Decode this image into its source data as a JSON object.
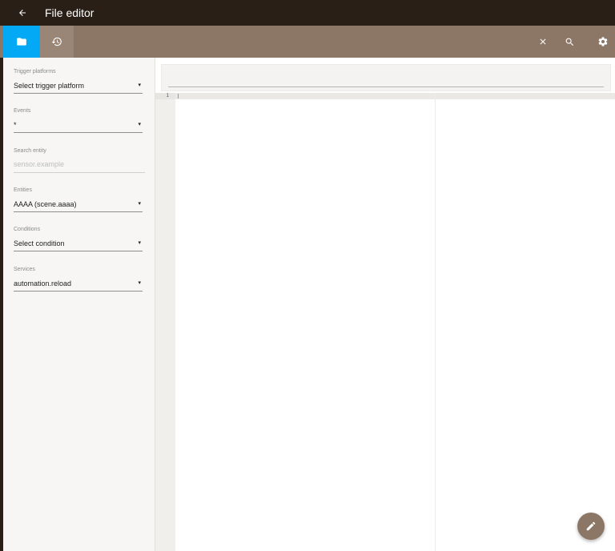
{
  "header": {
    "title": "File editor",
    "back_icon": "arrow-back-icon",
    "background": "#2a1f16"
  },
  "toolbar": {
    "background": "#8c7766",
    "accent": "#03a9f4",
    "buttons": [
      {
        "icon": "folder-icon",
        "active": true
      },
      {
        "icon": "history-icon"
      },
      {
        "icon": "close-icon"
      },
      {
        "icon": "search-icon"
      },
      {
        "icon": "settings-gear-icon"
      }
    ]
  },
  "sidebar": {
    "trigger_platforms": {
      "label": "Trigger platforms",
      "value": "Select trigger platform"
    },
    "events": {
      "label": "Events",
      "value": "*"
    },
    "search_entity": {
      "label": "Search entity",
      "placeholder": "sensor.example"
    },
    "entities": {
      "label": "Entities",
      "value": "AAAA (scene.aaaa)"
    },
    "conditions": {
      "label": "Conditions",
      "value": "Select condition"
    },
    "services": {
      "label": "Services",
      "value": "automation.reload"
    },
    "caret": "▾"
  },
  "editor": {
    "line_numbers": [
      "1"
    ]
  },
  "fab": {
    "icon": "pencil-edit-icon"
  }
}
